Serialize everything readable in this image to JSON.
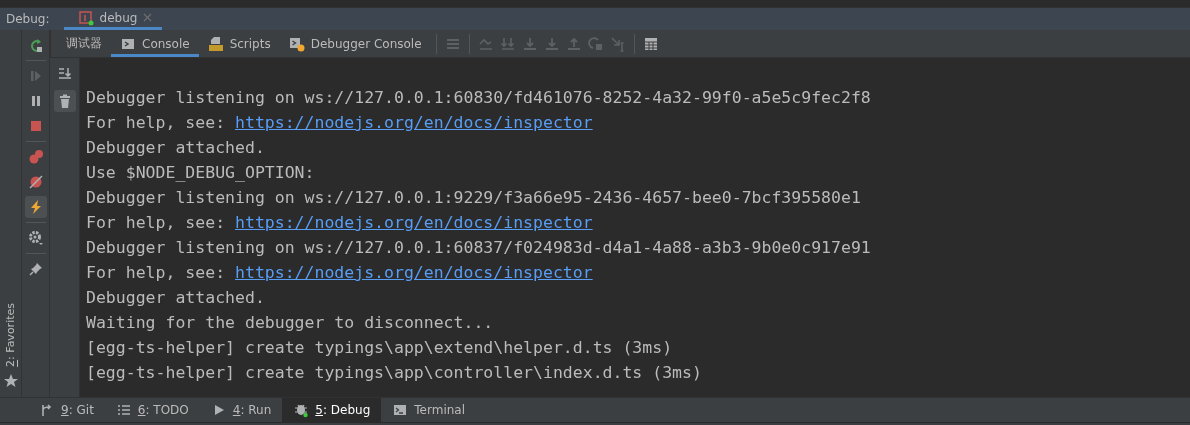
{
  "header": {
    "label": "Debug:",
    "tabs": [
      {
        "label": "debug",
        "selected": true
      }
    ]
  },
  "toolbar": {
    "tabs": [
      {
        "label": "调试器",
        "kind": "plain",
        "selected": false
      },
      {
        "label": "Console",
        "kind": "console",
        "selected": true
      },
      {
        "label": "Scripts",
        "kind": "scripts",
        "selected": false
      },
      {
        "label": "Debugger Console",
        "kind": "debugger",
        "selected": false
      }
    ],
    "actions": [
      {
        "kind": "frames",
        "disabled": true
      },
      {
        "kind": "step-over",
        "disabled": true
      },
      {
        "kind": "step-into",
        "disabled": true
      },
      {
        "kind": "force-step-into",
        "disabled": true
      },
      {
        "kind": "step-down",
        "disabled": true
      },
      {
        "kind": "step-out",
        "disabled": true
      },
      {
        "kind": "run-to-cursor",
        "disabled": true
      },
      {
        "kind": "evaluate",
        "disabled": true
      },
      {
        "kind": "table",
        "disabled": false
      }
    ]
  },
  "debug_actions": [
    {
      "kind": "rerun",
      "active": false,
      "disabled": false
    },
    {
      "kind": "resume",
      "active": false,
      "disabled": true
    },
    {
      "kind": "pause",
      "active": false,
      "disabled": false
    },
    {
      "kind": "stop",
      "active": false,
      "disabled": false
    },
    {
      "kind": "breakpoints",
      "active": false,
      "disabled": false
    },
    {
      "kind": "mute",
      "active": false,
      "disabled": false
    },
    {
      "kind": "lightning",
      "active": true,
      "disabled": false
    },
    {
      "kind": "settings",
      "active": false,
      "disabled": false
    },
    {
      "kind": "pin",
      "active": false,
      "disabled": false
    }
  ],
  "console_actions": [
    {
      "kind": "scroll-end",
      "active": false
    },
    {
      "kind": "trash",
      "active": true
    }
  ],
  "console_lines": [
    {
      "text": "Debugger listening on ws://127.0.0.1:60830/fd461076-8252-4a32-99f0-a5e5c9fec2f8"
    },
    {
      "text": "For help, see: ",
      "link": "https://nodejs.org/en/docs/inspector"
    },
    {
      "text": "Debugger attached."
    },
    {
      "text": "Use $NODE_DEBUG_OPTION:"
    },
    {
      "text": "Debugger listening on ws://127.0.0.1:9229/f3a66e95-2436-4657-bee0-7bcf395580e1"
    },
    {
      "text": "For help, see: ",
      "link": "https://nodejs.org/en/docs/inspector"
    },
    {
      "text": "Debugger listening on ws://127.0.0.1:60837/f024983d-d4a1-4a88-a3b3-9b0e0c917e91"
    },
    {
      "text": "For help, see: ",
      "link": "https://nodejs.org/en/docs/inspector"
    },
    {
      "text": "Debugger attached."
    },
    {
      "text": "Waiting for the debugger to disconnect..."
    },
    {
      "text": "[egg-ts-helper] create typings\\app\\extend\\helper.d.ts (3ms)"
    },
    {
      "text": "[egg-ts-helper] create typings\\app\\controller\\index.d.ts (3ms)"
    }
  ],
  "side_strip": {
    "key": "2",
    "label": ": Favorites"
  },
  "bottom_tabs": [
    {
      "key": "9",
      "label": ": Git",
      "kind": "git",
      "selected": false
    },
    {
      "key": "6",
      "label": ": TODO",
      "kind": "todo",
      "selected": false
    },
    {
      "key": "4",
      "label": ": Run",
      "kind": "run",
      "selected": false
    },
    {
      "key": "5",
      "label": ": Debug",
      "kind": "debug",
      "selected": true
    },
    {
      "label": "Terminal",
      "kind": "terminal",
      "selected": false
    }
  ]
}
